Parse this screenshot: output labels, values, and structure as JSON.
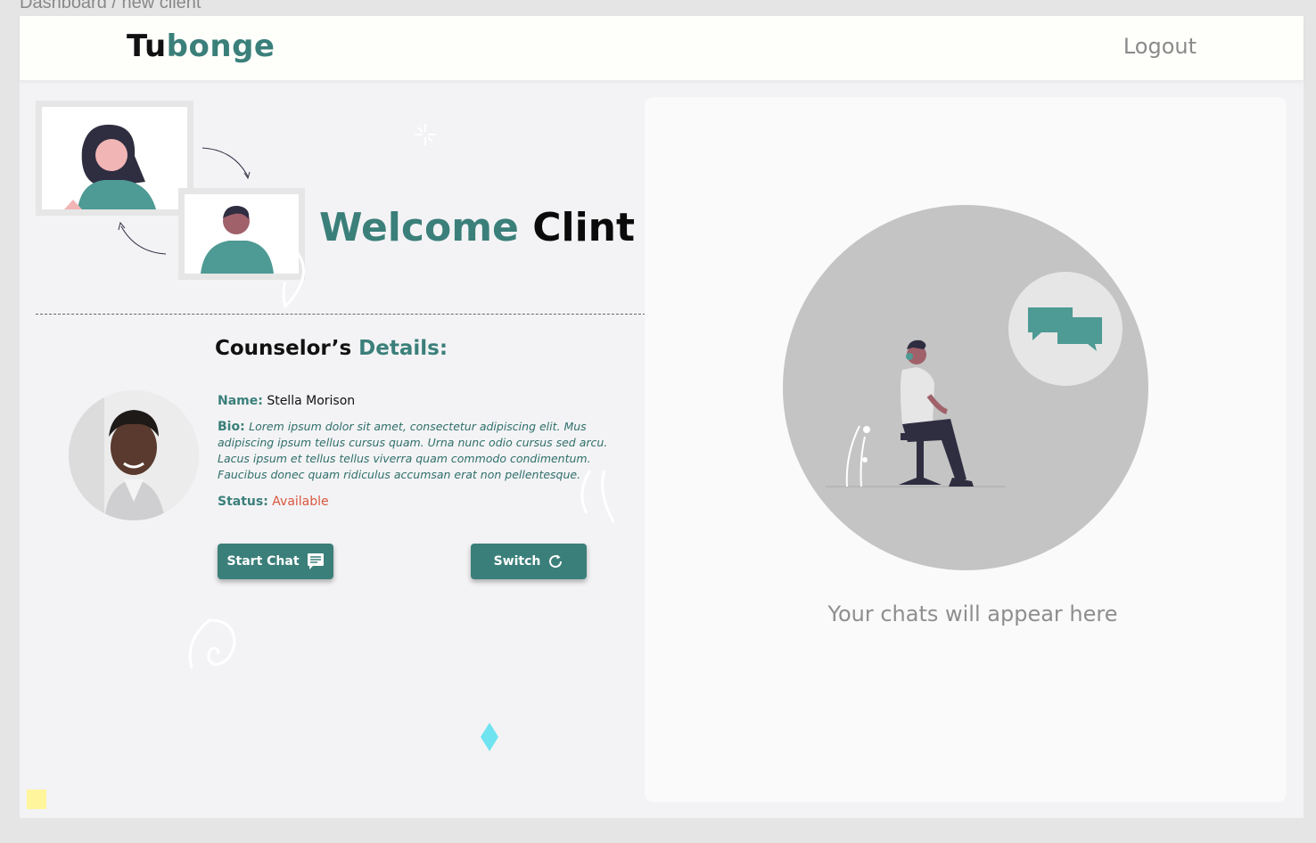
{
  "breadcrumb": "Dashboard / new client",
  "header": {
    "logo_part1": "Tu",
    "logo_part2": "bonge",
    "logout_label": "Logout"
  },
  "welcome": {
    "word": "Welcome",
    "name": "Clint"
  },
  "counselor": {
    "section_title_part1": "Counselor’s",
    "section_title_part2": "Details:",
    "name_label": "Name:",
    "name_value": "Stella Morison",
    "bio_label": "Bio:",
    "bio_value": "Lorem ipsum dolor sit amet, consectetur adipiscing elit. Mus adipiscing ipsum tellus cursus quam. Urna nunc odio cursus sed arcu. Lacus ipsum et tellus tellus viverra quam commodo condimentum. Faucibus donec quam ridiculus accumsan erat non pellentesque.",
    "status_label": "Status:",
    "status_value": "Available"
  },
  "buttons": {
    "start_chat": "Start Chat",
    "switch": "Switch"
  },
  "chat_panel": {
    "empty_message": "Your chats will appear here"
  },
  "colors": {
    "accent": "#3b7f7a",
    "status_available": "#d9573f",
    "header_bg": "#fefefb",
    "panel_bg": "#fafafb"
  },
  "icons": {
    "chat": "message-square-icon",
    "switch": "refresh-icon"
  }
}
